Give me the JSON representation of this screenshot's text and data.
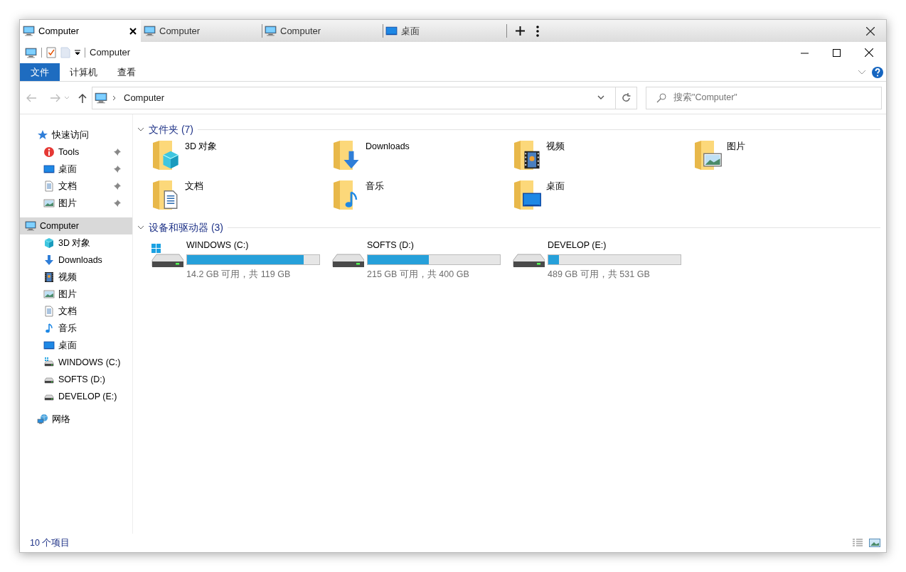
{
  "tabs": [
    {
      "label": "Computer",
      "kind": "computer",
      "selected": true
    },
    {
      "label": "Computer",
      "kind": "computer",
      "selected": false
    },
    {
      "label": "Computer",
      "kind": "computer",
      "selected": false
    },
    {
      "label": "桌面",
      "kind": "desktop",
      "selected": false
    }
  ],
  "title_bar": {
    "title": "Computer"
  },
  "ribbon": {
    "tabs": [
      {
        "label": "文件",
        "selected": true
      },
      {
        "label": "计算机",
        "selected": false
      },
      {
        "label": "查看",
        "selected": false
      }
    ]
  },
  "address_bar": {
    "path": "Computer",
    "search_placeholder": "搜索\"Computer\""
  },
  "navigation": [
    {
      "label": "快速访问",
      "kind": "star",
      "selected": false,
      "children": [
        {
          "label": "Tools",
          "kind": "tools",
          "selected": false,
          "pinned": true
        },
        {
          "label": "桌面",
          "kind": "desktop",
          "selected": false,
          "pinned": true
        },
        {
          "label": "文档",
          "kind": "document",
          "selected": false,
          "pinned": true
        },
        {
          "label": "图片",
          "kind": "picture",
          "selected": false,
          "pinned": true
        }
      ]
    },
    {
      "label": "Computer",
      "kind": "computer",
      "selected": true,
      "children": [
        {
          "label": "3D 对象",
          "kind": "cube",
          "selected": false,
          "pinned": false
        },
        {
          "label": "Downloads",
          "kind": "download",
          "selected": false,
          "pinned": false
        },
        {
          "label": "视频",
          "kind": "video",
          "selected": false,
          "pinned": false
        },
        {
          "label": "图片",
          "kind": "picture",
          "selected": false,
          "pinned": false
        },
        {
          "label": "文档",
          "kind": "document",
          "selected": false,
          "pinned": false
        },
        {
          "label": "音乐",
          "kind": "music",
          "selected": false,
          "pinned": false
        },
        {
          "label": "桌面",
          "kind": "desktop",
          "selected": false,
          "pinned": false
        },
        {
          "label": "WINDOWS (C:)",
          "kind": "system",
          "selected": false,
          "pinned": false
        },
        {
          "label": "SOFTS (D:)",
          "kind": "drive",
          "selected": false,
          "pinned": false
        },
        {
          "label": "DEVELOP (E:)",
          "kind": "drive",
          "selected": false,
          "pinned": false
        }
      ]
    },
    {
      "label": "网络",
      "kind": "network",
      "selected": false
    }
  ],
  "groups": [
    {
      "title": "文件夹 (7)",
      "kind": "folders",
      "expanded": true,
      "items": [
        {
          "label": "3D 对象",
          "kind": "cube"
        },
        {
          "label": "Downloads",
          "kind": "download"
        },
        {
          "label": "视频",
          "kind": "video"
        },
        {
          "label": "图片",
          "kind": "picture"
        },
        {
          "label": "文档",
          "kind": "document"
        },
        {
          "label": "音乐",
          "kind": "music"
        },
        {
          "label": "桌面",
          "kind": "desktop"
        }
      ]
    },
    {
      "title": "设备和驱动器 (3)",
      "kind": "drives",
      "expanded": true,
      "items": [
        {
          "label": "WINDOWS (C:)",
          "kind": "system",
          "level": 0.88,
          "space": "14.2 GB 可用，共 119 GB"
        },
        {
          "label": "SOFTS (D:)",
          "kind": "drive",
          "level": 0.46,
          "space": "215 GB 可用，共 400 GB"
        },
        {
          "label": "DEVELOP (E:)",
          "kind": "drive",
          "level": 0.08,
          "space": "489 GB 可用，共 531 GB"
        }
      ]
    }
  ],
  "status_bar": {
    "item_count": "10 个项目"
  }
}
